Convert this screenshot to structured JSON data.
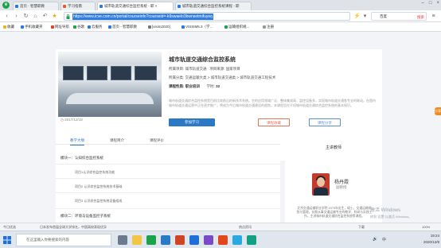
{
  "browser": {
    "tabs": [
      {
        "label": "首页 - 智慧职教",
        "fav": "#2a7ae2"
      },
      {
        "label": "学习指南",
        "fav": "#e55d2a"
      },
      {
        "label": "城市轨道交通综合监控系统 - 职 ×",
        "fav": "#2a7ae2"
      },
      {
        "label": "城市轨道交通综合监控系统课程 - 职",
        "fav": "#2a7ae2"
      }
    ],
    "url": "https://www.icve.com.cn/portal/courseinfo?courseid=-k9swaelo3bwnsetmifuyeq",
    "search_placeholder": "百度",
    "search_label": "搜索"
  },
  "bookmarks": [
    {
      "label": "收藏",
      "color": "#f0b323"
    },
    {
      "label": "手机收藏夹",
      "color": "#2a7ae2"
    },
    {
      "label": "网址导航",
      "color": "#e33c2b"
    },
    {
      "label": "谷歌",
      "color": "#1aa34a"
    },
    {
      "label": "云服务",
      "color": "#2a7ae2"
    },
    {
      "label": "首页 - 智慧职教",
      "color": "#2a7ae2"
    },
    {
      "label": "[visim2020]",
      "color": "#777777"
    },
    {
      "label": "VISSIM5.3（学…",
      "color": "#2a7ae2"
    },
    {
      "label": "运输组织规...",
      "color": "#1aa34a"
    },
    {
      "label": "注册",
      "color": "#999999"
    }
  ],
  "course": {
    "title": "城市轨道交通综合监控系统",
    "project_label": "所属项目:",
    "project_value": "城市轨道交通",
    "project_source_label": "项目来源:",
    "project_source_value": "国家项目",
    "category_label": "所属分类:",
    "category_value": "交通运输大类 > 城市轨道交通类 > 城市轨道交通工程技术",
    "nature_label": "课程性质:",
    "nature_value": "职业培训",
    "credits_label": "学时:",
    "credits_value": "32",
    "description": "城市轨道交通综合监控系统是目前比较前沿的新技术系统。它的应用领域广泛、整体集成高、监控设备多，实现城市轨道交通各专业的联动。在国内城市轨道交通运营中正在逐步推广，将成为今后城市轨道交通建设的趋势。本课程旨在介绍城市轨道交通综合监控系统的基本知识。",
    "date": "2017/12/18",
    "views": "261",
    "btn_join": "参加学习",
    "btn_fav": "课程收藏",
    "btn_share": "课程分享"
  },
  "tabs": [
    {
      "label": "教学大纲"
    },
    {
      "label": "课程简介"
    },
    {
      "label": "课程评价"
    }
  ],
  "outline": {
    "modules": [
      {
        "title": "模块一：认知综合监控系统",
        "sections": [
          "项目1认识综合监控系统功能",
          "项目2 认识综合监控系统技术基础",
          "项目3 认识综合监控系统设备组成"
        ]
      },
      {
        "title": "模块二：环境与设备监控子系统",
        "sections": []
      }
    ]
  },
  "teacher": {
    "heading": "主讲教师",
    "name": "杨丹霞",
    "rank": "副教授",
    "bio": "北京交通运输职业学院 1975年出生，硕士，交通运输规划与管理，长期从事交通运输专业的教学、科研与实践工作，主讲城市轨道交通综合监控系统等课程。"
  },
  "side_float": "分享",
  "watermark": {
    "line1": "激活 Windows",
    "line2": "转到\"设置\"以激活 Windows。"
  },
  "statusbar": {
    "left": "今日优选",
    "mid": "日本发布首届全球大学排名，中国高校表现优异",
    "right1": "热点资讯",
    "right2": "下载",
    "zoom": "100%"
  },
  "taskbar": {
    "search_placeholder": "在这里输入你要搜索的内容",
    "time": "19:24",
    "date": "2020/12/8",
    "lang": "中"
  }
}
